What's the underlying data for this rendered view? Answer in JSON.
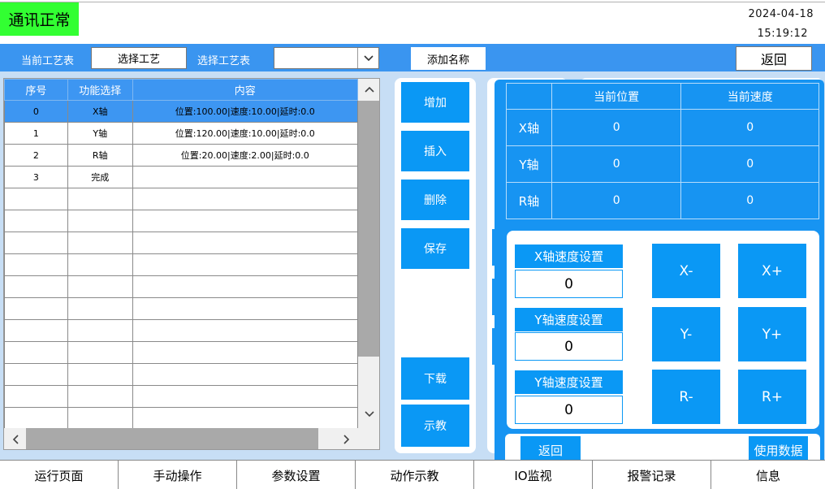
{
  "header": {
    "status": "通讯正常",
    "date": "2024-04-18",
    "time": "15:19:12"
  },
  "toolbar": {
    "current_process_label": "当前工艺表",
    "current_process_value": "选择工艺",
    "select_process_label": "选择工艺表",
    "select_process_value": "",
    "add_name_label": "添加名称",
    "return_label": "返回"
  },
  "table": {
    "headers": [
      "序号",
      "功能选择",
      "内容"
    ],
    "rows": [
      {
        "no": "0",
        "func": "X轴",
        "content": "位置:100.00|速度:10.00|延时:0.0",
        "selected": true
      },
      {
        "no": "1",
        "func": "Y轴",
        "content": "位置:120.00|速度:10.00|延时:0.0"
      },
      {
        "no": "2",
        "func": "R轴",
        "content": "位置:20.00|速度:2.00|延时:0.0"
      },
      {
        "no": "3",
        "func": "完成",
        "content": ""
      }
    ]
  },
  "actions": {
    "add": "增加",
    "insert": "插入",
    "delete": "删除",
    "save": "保存",
    "download": "下载",
    "teach": "示教"
  },
  "position_table": {
    "headers": [
      "当前位置",
      "当前速度"
    ],
    "rows": [
      {
        "axis": "X轴",
        "position": "0",
        "speed": "0"
      },
      {
        "axis": "Y轴",
        "position": "0",
        "speed": "0"
      },
      {
        "axis": "R轴",
        "position": "0",
        "speed": "0"
      }
    ]
  },
  "speed_settings": [
    {
      "label": "X轴速度设置",
      "value": "0"
    },
    {
      "label": "Y轴速度设置",
      "value": "0"
    },
    {
      "label": "Y轴速度设置",
      "value": "0"
    }
  ],
  "jog": {
    "x_minus": "X-",
    "x_plus": "X+",
    "y_minus": "Y-",
    "y_plus": "Y+",
    "r_minus": "R-",
    "r_plus": "R+"
  },
  "panel_footer": {
    "return": "返回",
    "use_data": "使用数据"
  },
  "bottom_nav": [
    "运行页面",
    "手动操作",
    "参数设置",
    "动作示教",
    "IO监视",
    "报警记录",
    "信息"
  ],
  "colors": {
    "status_green": "#32ff32",
    "toolbar_blue": "#3a95f0",
    "button_blue": "#0a98f5",
    "content_bg": "#c7def5"
  }
}
